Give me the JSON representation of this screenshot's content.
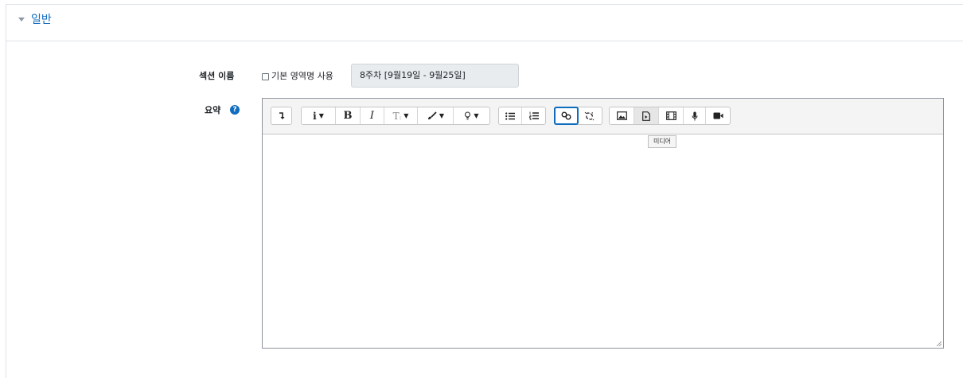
{
  "section": {
    "title": "일반",
    "collapse_icon": "caret-down-icon"
  },
  "fields": {
    "section_name": {
      "label": "섹션 이름",
      "checkbox_label": "기본 영역명 사용",
      "checked": false,
      "value": "8주차 [9월19일 - 9월25일]"
    },
    "summary": {
      "label": "요약",
      "help_icon": "question-circle-icon"
    }
  },
  "editor": {
    "toolbar": [
      [
        "collapse-toolbar-icon"
      ],
      [
        "info-style-icon",
        "bold-icon",
        "italic-icon",
        "font-size-icon",
        "font-color-icon",
        "accessibility-icon"
      ],
      [
        "unordered-list-icon",
        "ordered-list-icon"
      ],
      [
        "link-icon",
        "unlink-icon"
      ],
      [
        "image-icon",
        "media-icon",
        "manage-files-icon",
        "record-audio-icon",
        "record-video-icon"
      ]
    ],
    "tooltip": "미디어"
  },
  "colors": {
    "link": "#0f6cbf",
    "border": "#dee2e6"
  }
}
